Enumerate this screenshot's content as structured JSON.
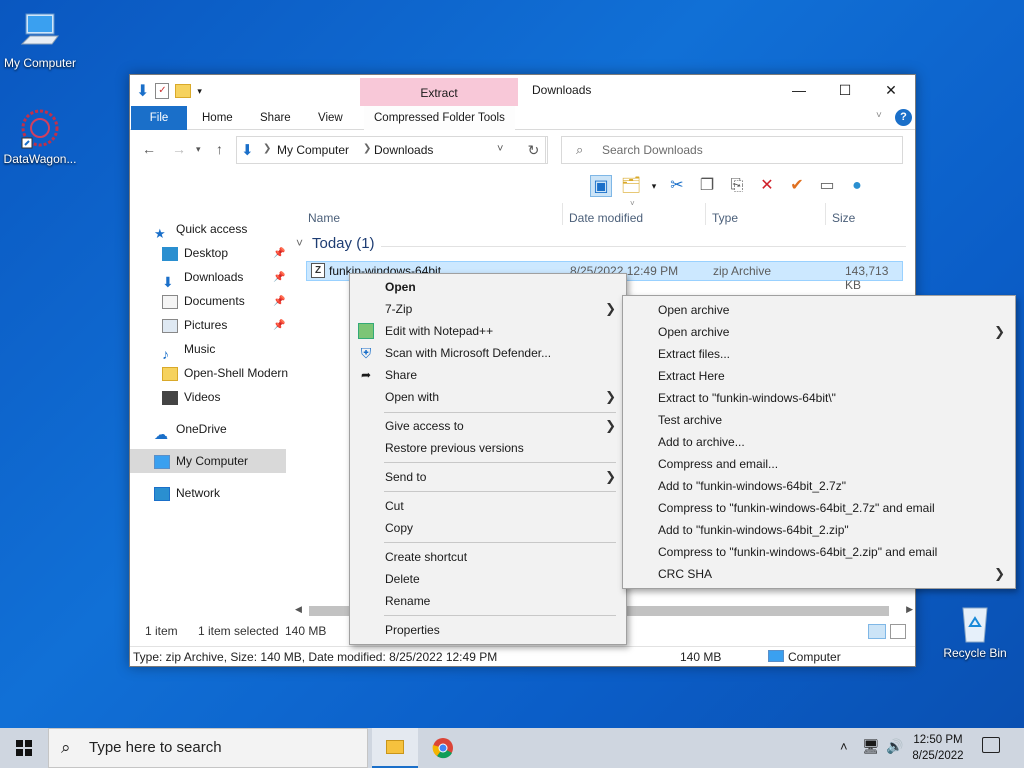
{
  "desktop": {
    "icons": [
      {
        "label": "My Computer"
      },
      {
        "label": "DataWagon..."
      },
      {
        "label": "Recycle Bin"
      }
    ]
  },
  "window": {
    "title": "Downloads",
    "contextual_tab_header": "Extract",
    "tabs": [
      "File",
      "Home",
      "Share",
      "View",
      "Compressed Folder Tools"
    ],
    "breadcrumb": [
      "My Computer",
      "Downloads"
    ],
    "search_placeholder": "Search Downloads",
    "columns": [
      "Name",
      "Date modified",
      "Type",
      "Size"
    ],
    "group_header": "Today (1)",
    "file": {
      "name": "funkin-windows-64bit",
      "date": "8/25/2022 12:49 PM",
      "type": "zip Archive",
      "size": "143,713 KB"
    },
    "nav": {
      "quick_access": "Quick access",
      "items": [
        "Desktop",
        "Downloads",
        "Documents",
        "Pictures",
        "Music",
        "Open-Shell Modern",
        "Videos"
      ],
      "onedrive": "OneDrive",
      "my_computer": "My Computer",
      "network": "Network"
    },
    "status": {
      "count": "1 item",
      "selected": "1 item selected",
      "size": "140 MB"
    },
    "details_bar": {
      "text": "Type: zip Archive, Size: 140 MB, Date modified: 8/25/2022 12:49 PM",
      "size": "140 MB",
      "location": "Computer"
    }
  },
  "context_menu": {
    "items": [
      "Open",
      "7-Zip",
      "Edit with Notepad++",
      "Scan with Microsoft Defender...",
      "Share",
      "Open with",
      "Give access to",
      "Restore previous versions",
      "Send to",
      "Cut",
      "Copy",
      "Create shortcut",
      "Delete",
      "Rename",
      "Properties"
    ]
  },
  "submenu_7zip": {
    "items": [
      "Open archive",
      "Open archive",
      "Extract files...",
      "Extract Here",
      "Extract to \"funkin-windows-64bit\\\"",
      "Test archive",
      "Add to archive...",
      "Compress and email...",
      "Add to \"funkin-windows-64bit_2.7z\"",
      "Compress to \"funkin-windows-64bit_2.7z\" and email",
      "Add to \"funkin-windows-64bit_2.zip\"",
      "Compress to \"funkin-windows-64bit_2.zip\" and email",
      "CRC SHA"
    ]
  },
  "taskbar": {
    "search_placeholder": "Type here to search",
    "time": "12:50 PM",
    "date": "8/25/2022"
  },
  "colors": {
    "desktop": "#0b5ec8",
    "file_tab": "#1a6fc9",
    "context_tab": "#f8c8d8",
    "selection": "#cce8ff",
    "menu_bg": "#f2f2f2"
  }
}
